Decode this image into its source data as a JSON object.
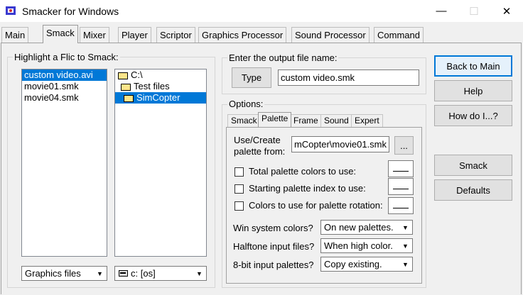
{
  "window": {
    "title": "Smacker for Windows",
    "minimize": "—",
    "maximize": "☐",
    "close": "✕"
  },
  "tabs": [
    {
      "label": "Main"
    },
    {
      "label": "Smack"
    },
    {
      "label": "Mixer"
    },
    {
      "label": "Player"
    },
    {
      "label": "Scriptor"
    },
    {
      "label": "Graphics Processor"
    },
    {
      "label": "Sound Processor"
    },
    {
      "label": "Command"
    }
  ],
  "left_group": {
    "label": "Highlight a Flic to Smack:",
    "files": [
      "custom video.avi",
      "movie01.smk",
      "movie04.smk"
    ],
    "selected_file": "custom video.avi",
    "folders": [
      {
        "label": "C:\\"
      },
      {
        "label": "Test files"
      },
      {
        "label": "SimCopter"
      }
    ],
    "filter_value": "Graphics files",
    "drive_value": "c: [os]"
  },
  "output_group": {
    "label": "Enter the output file name:",
    "type_button": "Type",
    "filename": "custom video.smk"
  },
  "options_group": {
    "label": "Options:",
    "subtabs": [
      "Smack",
      "Palette",
      "Frame",
      "Sound",
      "Expert"
    ],
    "palette_from_label_1": "Use/Create",
    "palette_from_label_2": "palette from:",
    "palette_from_value": "mCopter\\movie01.smk",
    "browse_button": "...",
    "checkboxes": [
      {
        "label": "Total palette colors to use:",
        "checked": false
      },
      {
        "label": "Starting palette index to use:",
        "checked": false
      },
      {
        "label": "Colors to use for palette rotation:",
        "checked": false
      }
    ],
    "dropdowns": [
      {
        "label": "Win system colors?",
        "value": "On new palettes."
      },
      {
        "label": "Halftone input files?",
        "value": "When high color."
      },
      {
        "label": "8-bit input palettes?",
        "value": "Copy existing."
      }
    ]
  },
  "right_buttons": {
    "back_to_main": "Back to Main",
    "help": "Help",
    "how_do_i": "How do I...?",
    "smack": "Smack",
    "defaults": "Defaults"
  }
}
